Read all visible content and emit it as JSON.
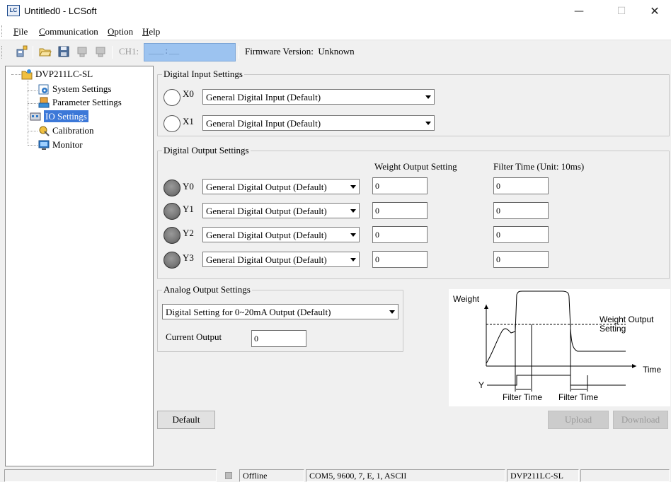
{
  "window": {
    "title": "Untitled0 - LCSoft",
    "icon_label": "LC"
  },
  "menu": {
    "items": [
      {
        "underline": "F",
        "rest": "ile"
      },
      {
        "underline": "C",
        "rest": "ommunication"
      },
      {
        "underline": "O",
        "rest": "ption"
      },
      {
        "underline": "H",
        "rest": "elp"
      }
    ]
  },
  "toolbar": {
    "channel_label": "CH1:",
    "channel_value": "___:__",
    "firmware_label": "Firmware Version:",
    "firmware_value": "Unknown"
  },
  "tree": {
    "root": "DVP211LC-SL",
    "items": [
      "System Settings",
      "Parameter Settings",
      "IO Settings",
      "Calibration",
      "Monitor"
    ]
  },
  "digital_input": {
    "title": "Digital Input Settings",
    "rows": [
      {
        "label": "X0",
        "mode": "General Digital Input (Default)"
      },
      {
        "label": "X1",
        "mode": "General Digital Input (Default)"
      }
    ]
  },
  "digital_output": {
    "title": "Digital Output Settings",
    "col_weight": "Weight Output Setting",
    "col_filter": "Filter Time (Unit: 10ms)",
    "rows": [
      {
        "label": "Y0",
        "mode": "General Digital Output (Default)",
        "weight": "0",
        "filter": "0"
      },
      {
        "label": "Y1",
        "mode": "General Digital Output (Default)",
        "weight": "0",
        "filter": "0"
      },
      {
        "label": "Y2",
        "mode": "General Digital Output (Default)",
        "weight": "0",
        "filter": "0"
      },
      {
        "label": "Y3",
        "mode": "General Digital Output (Default)",
        "weight": "0",
        "filter": "0"
      }
    ]
  },
  "analog_output": {
    "title": "Analog Output Settings",
    "mode": "Digital Setting for 0~20mA Output (Default)",
    "current_label": "Current Output",
    "current_value": "0"
  },
  "diagram": {
    "weight_label": "Weight",
    "setting_line1": "Weight Output",
    "setting_line2": "Setting",
    "time_label": "Time",
    "y_label": "Y",
    "filter_label_1": "Filter Time",
    "filter_label_2": "Filter Time"
  },
  "buttons": {
    "default": "Default",
    "upload": "Upload",
    "download": "Download"
  },
  "status": {
    "connection": "Offline",
    "port": "COM5, 9600, 7, E, 1, ASCII",
    "model": "DVP211LC-SL"
  },
  "colors": {
    "selection": "#3c78d8",
    "channel_field": "#9cc3f0"
  }
}
